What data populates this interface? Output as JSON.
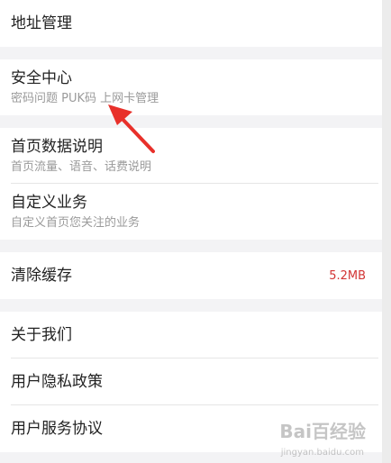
{
  "settings": {
    "address": {
      "title": "地址管理"
    },
    "security": {
      "title": "安全中心",
      "subtitle": "密码问题 PUK码 上网卡管理"
    },
    "homepage_data": {
      "title": "首页数据说明",
      "subtitle": "首页流量、语音、话费说明"
    },
    "custom_business": {
      "title": "自定义业务",
      "subtitle": "自定义首页您关注的业务"
    },
    "clear_cache": {
      "title": "清除缓存",
      "value": "5.2MB"
    },
    "about": {
      "title": "关于我们"
    },
    "privacy": {
      "title": "用户隐私政策"
    },
    "service": {
      "title": "用户服务协议"
    }
  },
  "colors": {
    "accent_red": "#d23434",
    "arrow_red": "#e8302a",
    "background": "#f3f3f5"
  },
  "watermark": {
    "brand": "Bai百经验",
    "url": "jingyan.baidu.com"
  }
}
